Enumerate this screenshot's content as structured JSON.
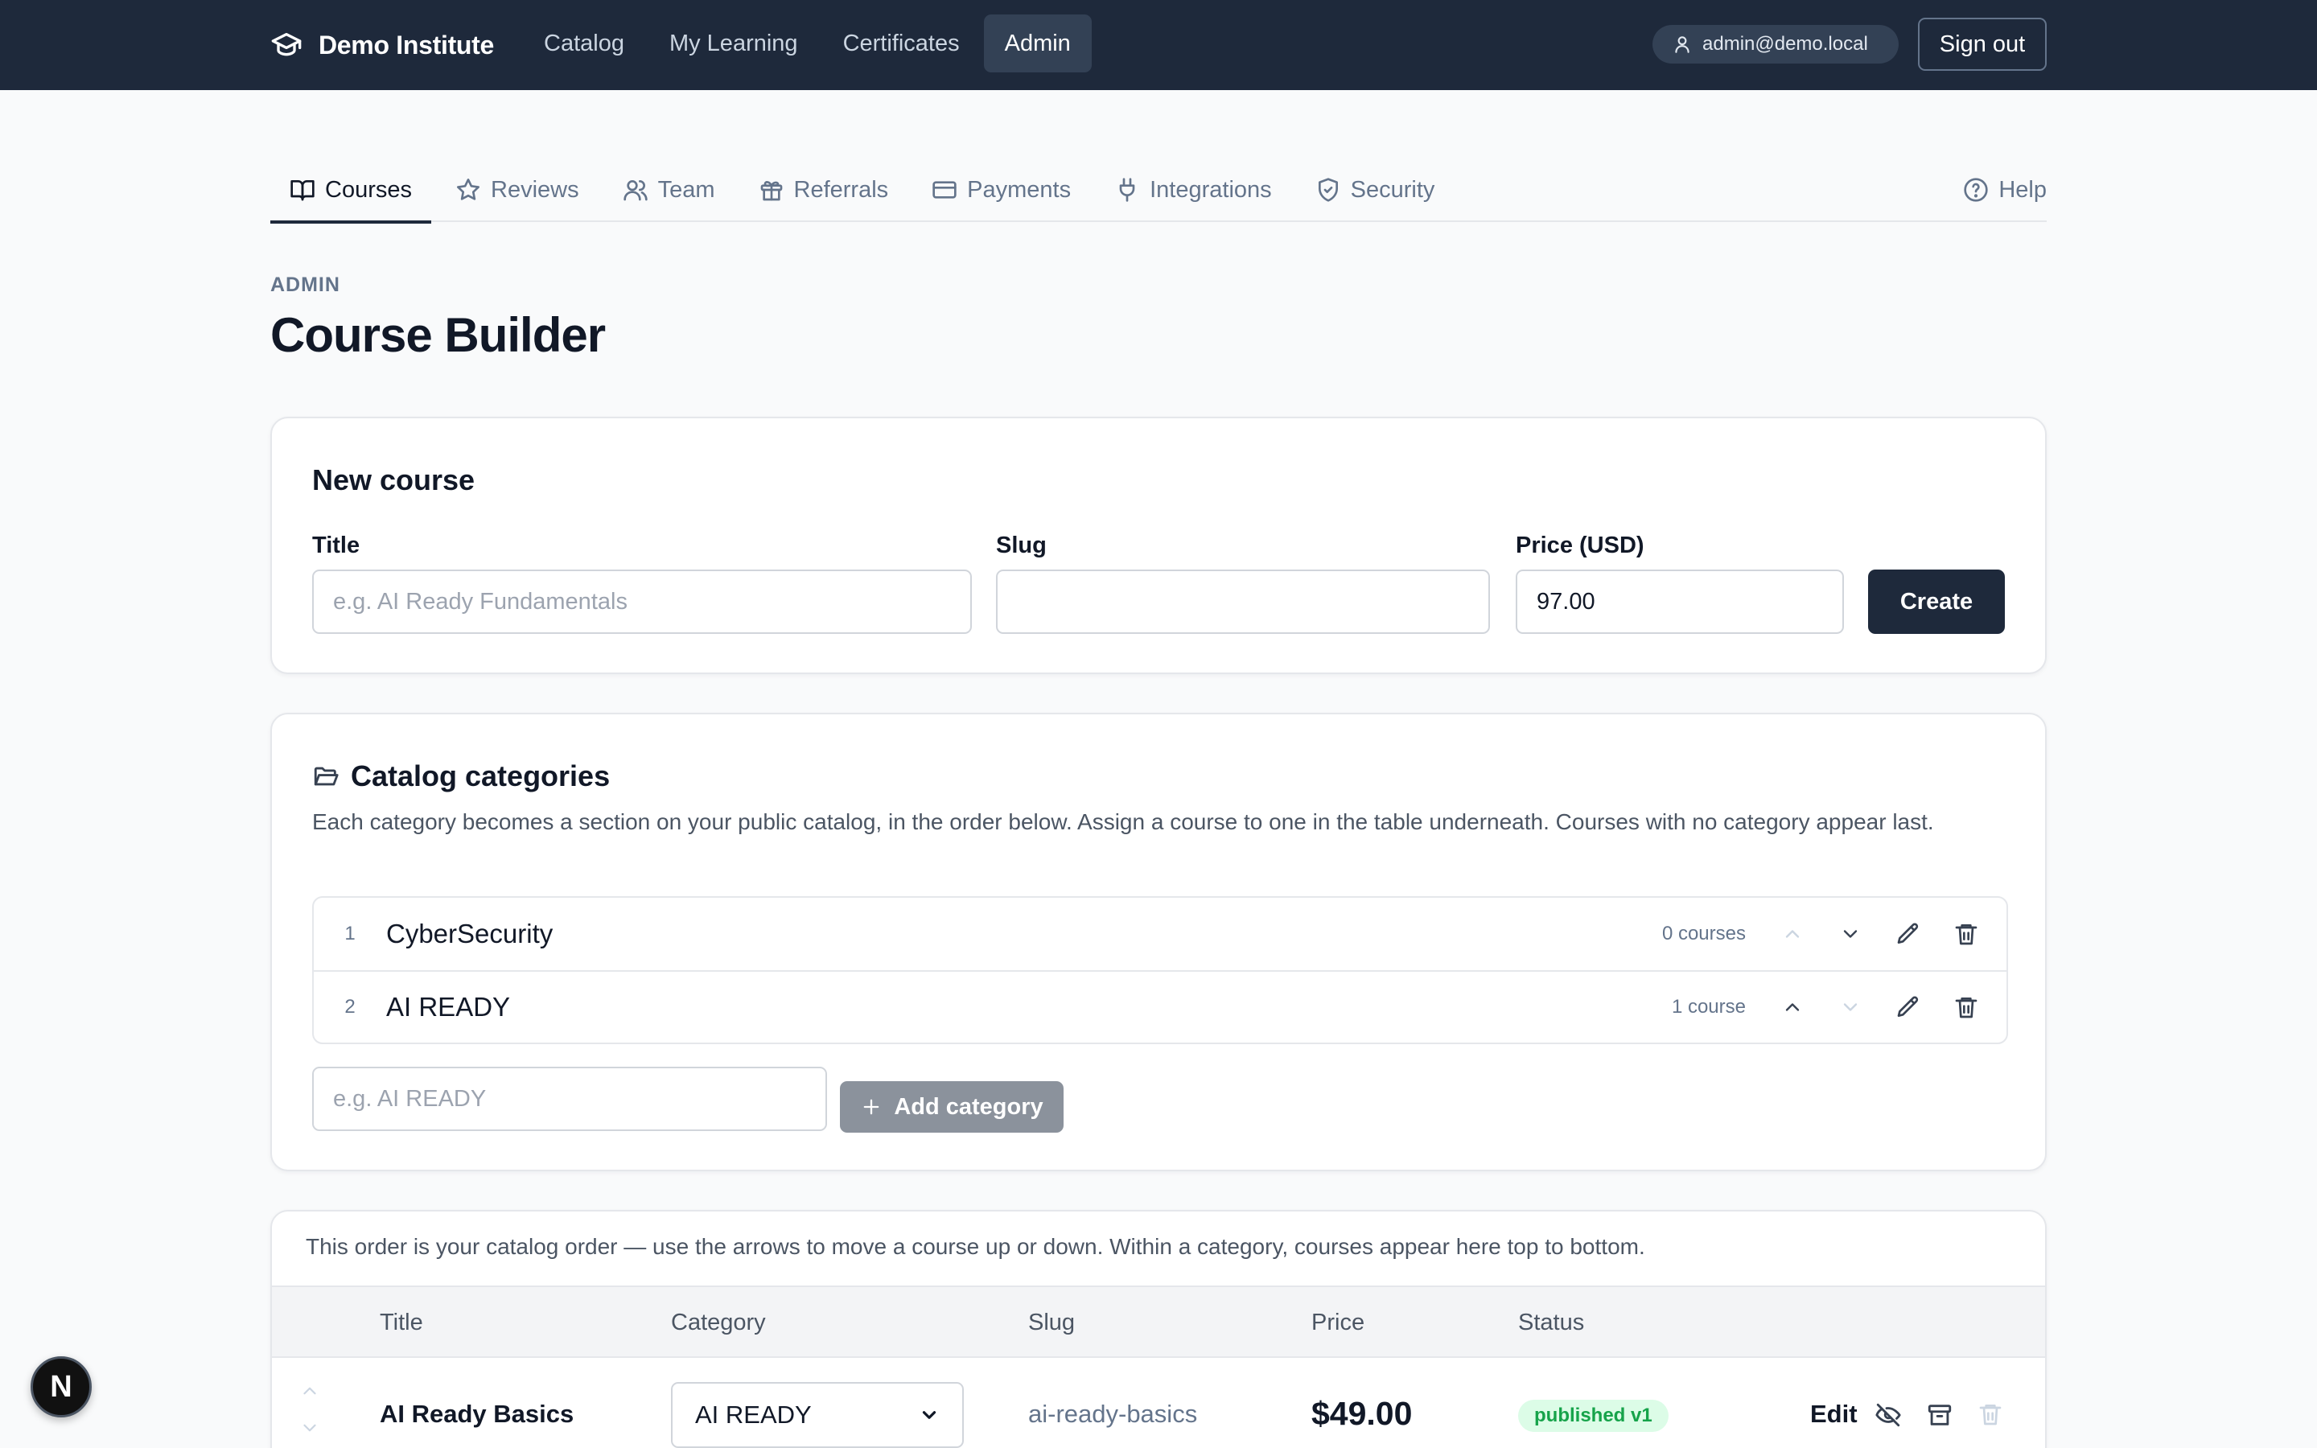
{
  "topbar": {
    "brand": "Demo Institute",
    "nav": [
      {
        "label": "Catalog",
        "active": false
      },
      {
        "label": "My Learning",
        "active": false
      },
      {
        "label": "Certificates",
        "active": false
      },
      {
        "label": "Admin",
        "active": true
      }
    ],
    "user_email": "admin@demo.local",
    "signout_label": "Sign out"
  },
  "tabs": [
    {
      "label": "Courses",
      "icon": "book-icon",
      "active": true
    },
    {
      "label": "Reviews",
      "icon": "star-icon",
      "active": false
    },
    {
      "label": "Team",
      "icon": "users-icon",
      "active": false
    },
    {
      "label": "Referrals",
      "icon": "gift-icon",
      "active": false
    },
    {
      "label": "Payments",
      "icon": "credit-card-icon",
      "active": false
    },
    {
      "label": "Integrations",
      "icon": "plug-icon",
      "active": false
    },
    {
      "label": "Security",
      "icon": "shield-icon",
      "active": false
    }
  ],
  "help_label": "Help",
  "page": {
    "eyebrow": "ADMIN",
    "title": "Course Builder"
  },
  "new_course": {
    "heading": "New course",
    "title_label": "Title",
    "title_placeholder": "e.g. AI Ready Fundamentals",
    "title_value": "",
    "slug_label": "Slug",
    "slug_value": "",
    "price_label": "Price (USD)",
    "price_value": "97.00",
    "create_label": "Create"
  },
  "categories": {
    "heading": "Catalog categories",
    "description": "Each category becomes a section on your public catalog, in the order below. Assign a course to one in the table underneath. Courses with no category appear last.",
    "items": [
      {
        "position": "1",
        "name": "CyberSecurity",
        "count": "0 courses",
        "up_enabled": false,
        "down_enabled": true
      },
      {
        "position": "2",
        "name": "AI READY",
        "count": "1 course",
        "up_enabled": true,
        "down_enabled": false
      }
    ],
    "new_placeholder": "e.g. AI READY",
    "add_label": "Add category"
  },
  "courses": {
    "note": "This order is your catalog order — use the arrows to move a course up or down. Within a category, courses appear here top to bottom.",
    "columns": [
      "Title",
      "Category",
      "Slug",
      "Price",
      "Status"
    ],
    "rows": [
      {
        "title": "AI Ready Basics",
        "category": "AI READY",
        "slug": "ai-ready-basics",
        "price": "$49.00",
        "status": "published v1",
        "edit_label": "Edit"
      }
    ]
  },
  "floating_badge": "N",
  "colors": {
    "nav_bg": "#1e293b",
    "primary_button": "#1e293b",
    "disabled_button": "#8b929c",
    "status_published_bg": "#dcfce7",
    "status_published_text": "#16a34a"
  }
}
